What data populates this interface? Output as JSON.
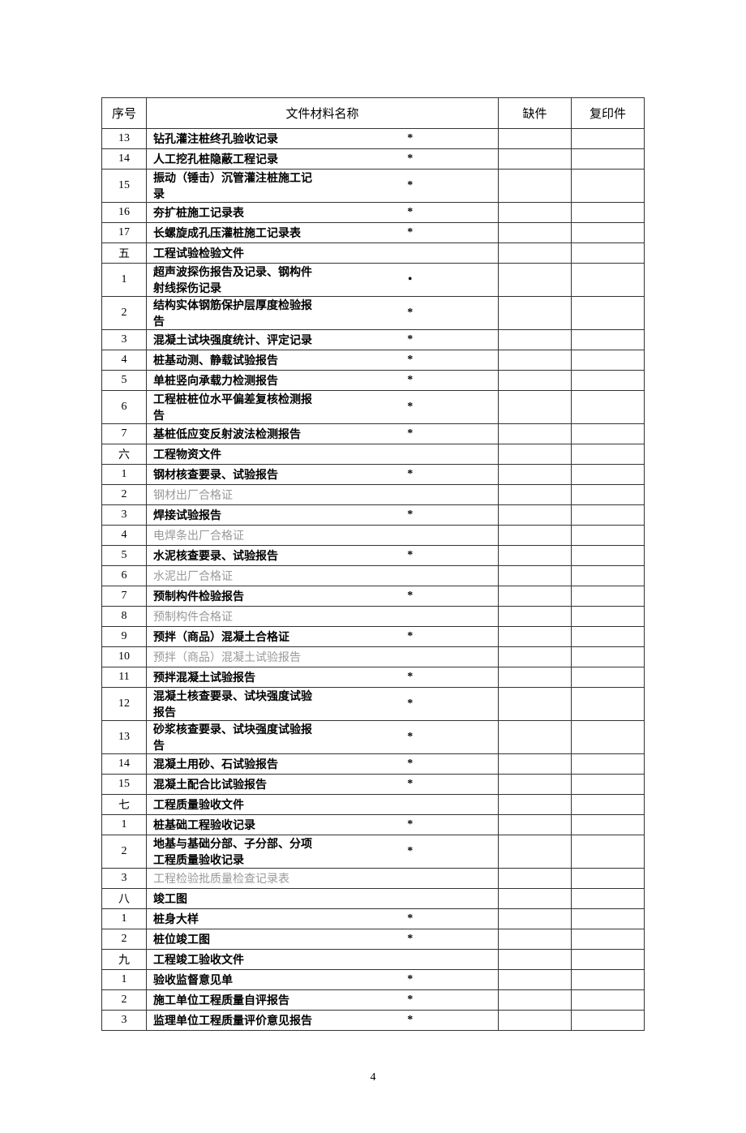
{
  "headers": {
    "seq": "序号",
    "name": "文件材料名称",
    "missing": "缺件",
    "copy": "复印件"
  },
  "rows": [
    {
      "seq": "13",
      "name": "钻孔灌注桩终孔验收记录",
      "mark": "*",
      "bold": true
    },
    {
      "seq": "14",
      "name": "人工挖孔桩隐蔽工程记录",
      "mark": "*",
      "bold": true
    },
    {
      "seq": "15",
      "name": "振动（锤击）沉管灌注桩施工记录",
      "mark": "*",
      "bold": true
    },
    {
      "seq": "16",
      "name": "夯扩桩施工记录表",
      "mark": "*",
      "bold": true
    },
    {
      "seq": "17",
      "name": "长螺旋成孔压灌桩施工记录表",
      "mark": "*",
      "bold": true
    },
    {
      "seq": "五",
      "name": "工程试验检验文件",
      "mark": "",
      "bold": true
    },
    {
      "seq": "1",
      "name": "超声波探伤报告及记录、钢构件射线探伤记录",
      "mark": "•",
      "bold": true
    },
    {
      "seq": "2",
      "name": "结构实体钢筋保护层厚度检验报告",
      "mark": "*",
      "bold": true
    },
    {
      "seq": "3",
      "name": "混凝土试块强度统计、评定记录",
      "mark": "*",
      "bold": true
    },
    {
      "seq": "4",
      "name": "桩基动测、静载试验报告",
      "mark": "*",
      "bold": true
    },
    {
      "seq": "5",
      "name": "单桩竖向承载力检测报告",
      "mark": "*",
      "bold": true
    },
    {
      "seq": "6",
      "name": "工程桩桩位水平偏差复核检测报告",
      "mark": "*",
      "bold": true
    },
    {
      "seq": "7",
      "name": "基桩低应变反射波法检测报告",
      "mark": "*",
      "bold": true
    },
    {
      "seq": "六",
      "name": "工程物资文件",
      "mark": "",
      "bold": true
    },
    {
      "seq": "1",
      "name": "钢材核查要录、试验报告",
      "mark": "*",
      "bold": true
    },
    {
      "seq": "2",
      "name": "钢材出厂合格证",
      "mark": "",
      "bold": false
    },
    {
      "seq": "3",
      "name": "焊接试验报告",
      "mark": "*",
      "bold": true
    },
    {
      "seq": "4",
      "name": "电焊条出厂合格证",
      "mark": "",
      "bold": false
    },
    {
      "seq": "5",
      "name": "水泥核查要录、试验报告",
      "mark": "*",
      "bold": true
    },
    {
      "seq": "6",
      "name": "水泥出厂合格证",
      "mark": "",
      "bold": false
    },
    {
      "seq": "7",
      "name": "预制构件检验报告",
      "mark": "*",
      "bold": true
    },
    {
      "seq": "8",
      "name": "预制构件合格证",
      "mark": "",
      "bold": false
    },
    {
      "seq": "9",
      "name": "预拌（商品）混凝土合格证",
      "mark": "*",
      "bold": true
    },
    {
      "seq": "10",
      "name": "预拌（商品）混凝土试验报告",
      "mark": "",
      "bold": false
    },
    {
      "seq": "11",
      "name": "预拌混凝土试验报告",
      "mark": "*",
      "bold": true
    },
    {
      "seq": "12",
      "name": "混凝土核查要录、试块强度试验报告",
      "mark": "*",
      "bold": true
    },
    {
      "seq": "13",
      "name": "砂浆核查要录、试块强度试验报告",
      "mark": "*",
      "bold": true
    },
    {
      "seq": "14",
      "name": "混凝土用砂、石试验报告",
      "mark": "*",
      "bold": true
    },
    {
      "seq": "15",
      "name": "混凝土配合比试验报告",
      "mark": "*",
      "bold": true
    },
    {
      "seq": "七",
      "name": "工程质量验收文件",
      "mark": "",
      "bold": true
    },
    {
      "seq": "1",
      "name": "桩基础工程验收记录",
      "mark": "*",
      "bold": true
    },
    {
      "seq": "2",
      "name": "地基与基础分部、子分部、分项工程质量验收记录",
      "mark": "*",
      "bold": true
    },
    {
      "seq": "3",
      "name": "工程检验批质量检查记录表",
      "mark": "",
      "bold": false
    },
    {
      "seq": "八",
      "name": "竣工图",
      "mark": "",
      "bold": true
    },
    {
      "seq": "1",
      "name": "桩身大样",
      "mark": "*",
      "bold": true
    },
    {
      "seq": "2",
      "name": "桩位竣工图",
      "mark": "*",
      "bold": true
    },
    {
      "seq": "九",
      "name": "工程竣工验收文件",
      "mark": "",
      "bold": true
    },
    {
      "seq": "1",
      "name": "验收监督意见单",
      "mark": "*",
      "bold": true
    },
    {
      "seq": "2",
      "name": "施工单位工程质量自评报告",
      "mark": "*",
      "bold": true
    },
    {
      "seq": "3",
      "name": "监理单位工程质量评价意见报告",
      "mark": "*",
      "bold": true
    }
  ],
  "page_number": "4"
}
